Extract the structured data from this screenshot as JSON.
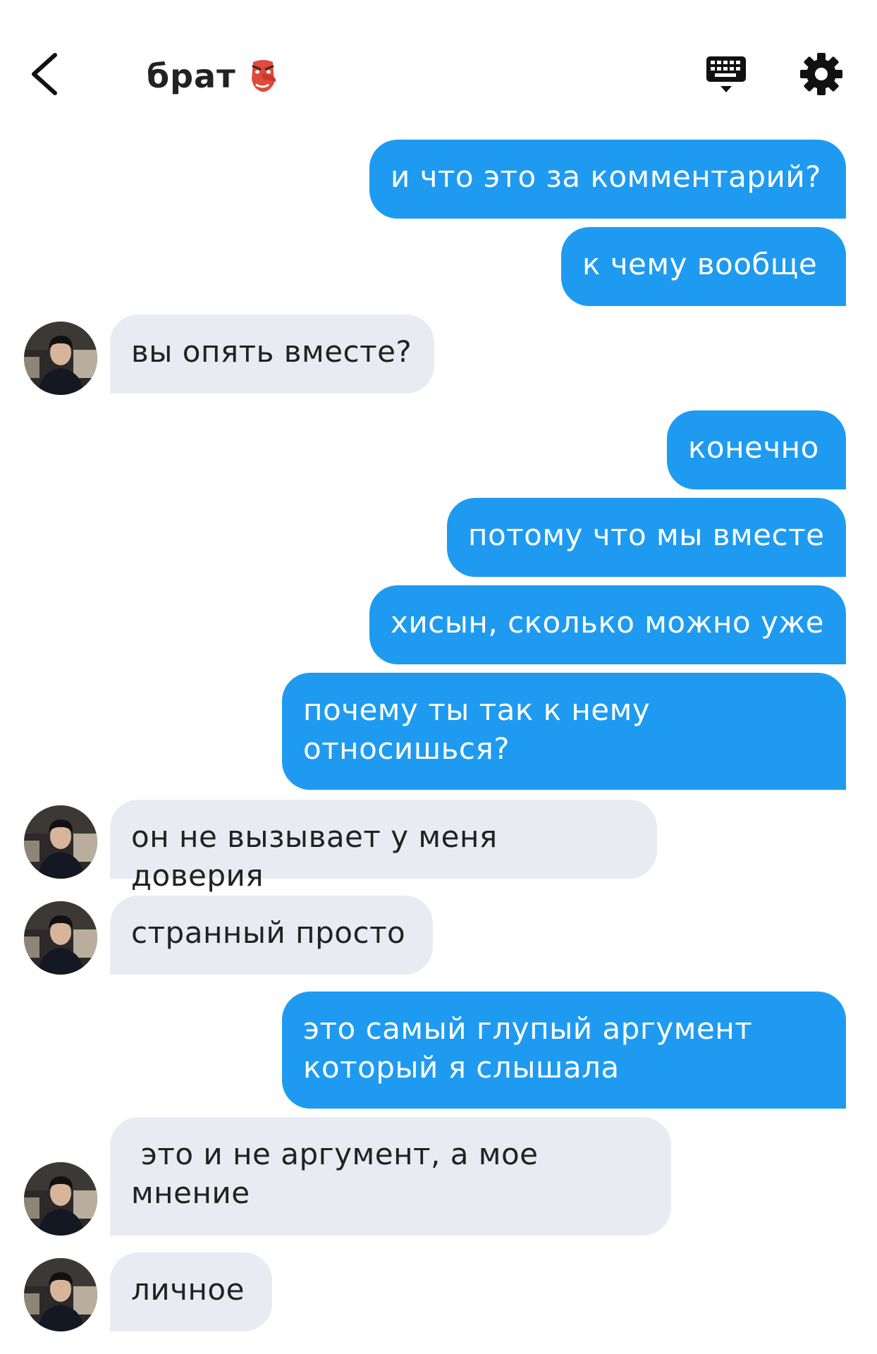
{
  "header": {
    "title": "брат",
    "back_icon": "chevron-left-icon",
    "title_emoji": "tengu-mask-emoji",
    "keyboard_icon": "keyboard-icon",
    "settings_icon": "gear-icon"
  },
  "colors": {
    "outgoing_bubble": "#1e9bf0",
    "incoming_bubble": "#e9ebf2",
    "text_dark": "#222222"
  },
  "messages": [
    {
      "side": "out",
      "text": "и что это за комментарий?"
    },
    {
      "side": "out",
      "text": "к чему вообще"
    },
    {
      "side": "in",
      "text": "вы опять вместе?"
    },
    {
      "side": "out",
      "text": "конечно"
    },
    {
      "side": "out",
      "text": "потому что мы вместе"
    },
    {
      "side": "out",
      "text": "хисын, сколько можно уже"
    },
    {
      "side": "out",
      "text": "почему ты так к нему относишься?"
    },
    {
      "side": "in",
      "text": "он не вызывает у меня доверия"
    },
    {
      "side": "in",
      "text": "странный просто"
    },
    {
      "side": "out",
      "text": "это самый глупый аргумент который я слышала"
    },
    {
      "side": "in",
      "text": " это и не аргумент, а мое мнение"
    },
    {
      "side": "in",
      "text": "личное"
    }
  ]
}
